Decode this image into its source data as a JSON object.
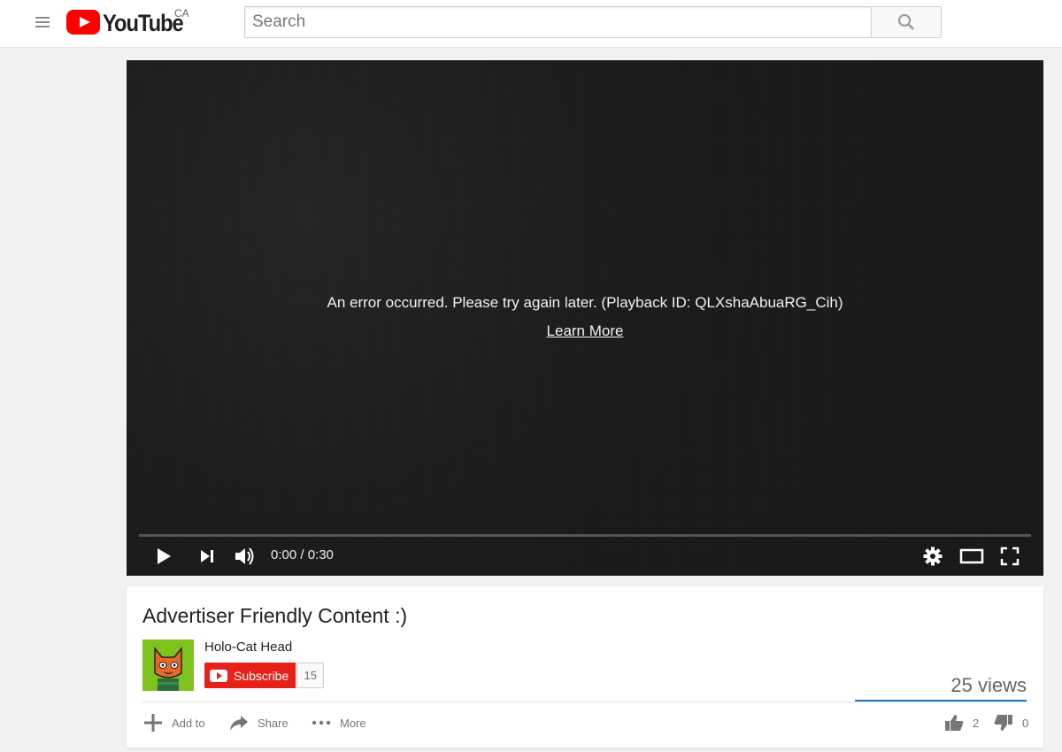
{
  "header": {
    "logo_text": "YouTube",
    "country_code": "CA",
    "search_placeholder": "Search"
  },
  "player": {
    "error_message": "An error occurred. Please try again later. (Playback ID: QLXshaAbuaRG_Cih)",
    "learn_more": "Learn More",
    "time_display": "0:00 / 0:30",
    "progress": 0
  },
  "video": {
    "title": "Advertiser Friendly Content :)",
    "views": "25 views"
  },
  "channel": {
    "name": "Holo-Cat Head",
    "subscribe_label": "Subscribe",
    "subscriber_count": "15"
  },
  "actions": {
    "add_to": "Add to",
    "share": "Share",
    "more": "More",
    "likes": "2",
    "dislikes": "0"
  },
  "colors": {
    "brand_red": "#ff0000",
    "subscribe_red": "#e62117",
    "views_bar_blue": "#167ac6"
  }
}
